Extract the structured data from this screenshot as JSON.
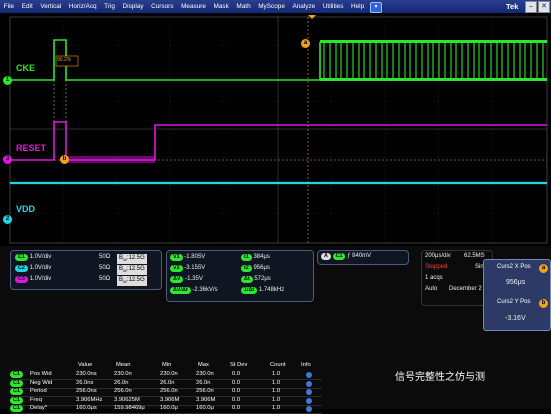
{
  "menubar": {
    "items": [
      "File",
      "Edit",
      "Vertical",
      "Horiz/Acq",
      "Trig",
      "Display",
      "Cursors",
      "Measure",
      "Mask",
      "Math",
      "MyScope",
      "Analyze",
      "Utilities",
      "Help"
    ],
    "help_glyph": "▾",
    "brand": "Tek",
    "min_glyph": "–",
    "close_glyph": "✕"
  },
  "waveform": {
    "channels": [
      {
        "label": "CKE",
        "marker": "1",
        "color": "#2ee62e"
      },
      {
        "label": "RESET",
        "marker": "3",
        "color": "#e016e0"
      },
      {
        "label": "VDD",
        "marker": "2",
        "color": "#1ed7e6"
      }
    ],
    "cursor_tags": {
      "a": "a",
      "b": "b"
    },
    "delta_readout": "90.2%",
    "trigger_marker": "T"
  },
  "channel_panel": {
    "rows": [
      {
        "ch": "C1",
        "scale": "1.0V/div",
        "imp": "50Ω",
        "bw_sym": "B",
        "bw_sub": "W",
        "bw": "12.5G"
      },
      {
        "ch": "C2",
        "scale": "1.0V/div",
        "imp": "50Ω",
        "bw_sym": "B",
        "bw_sub": "W",
        "bw": "12.5G"
      },
      {
        "ch": "C3",
        "scale": "1.0V/div",
        "imp": "50Ω",
        "bw_sym": "B",
        "bw_sub": "W",
        "bw": "12.5G"
      }
    ]
  },
  "cursor_panel": {
    "rows": [
      {
        "tag": "V1",
        "value": "-1.805V",
        "tag2": "t1",
        "value2": "384μs"
      },
      {
        "tag": "V2",
        "value": "-3.155V",
        "tag2": "t2",
        "value2": "956μs"
      },
      {
        "tag": "ΔV",
        "value": "-1.35V",
        "tag2": "Δt",
        "value2": "572μs"
      },
      {
        "tag": "ΔV/Δt",
        "value": "-2.36kV/s",
        "tag2": "1/Δt",
        "value2": "1.748kHz"
      }
    ]
  },
  "trigger_panel": {
    "source": "C1",
    "slope": "ƒ",
    "level": "840mV"
  },
  "acq_panel": {
    "timebase": "200μs/div",
    "rate": "62.5MS",
    "state": "Stopped",
    "single": "Sin",
    "acqs": "1 acqs",
    "mode": "Auto",
    "date": "December 2"
  },
  "cursor_popup": {
    "x_title": "Curs2 X Pos",
    "x_value": "956μs",
    "y_title": "Curs2 Y Pos",
    "y_value": "-3.16V",
    "x_tag": "a",
    "y_tag": "b"
  },
  "measurements": {
    "headers": [
      "Value",
      "Mean",
      "Min",
      "Max",
      "St Dev",
      "Count",
      "Info"
    ],
    "rows": [
      {
        "ch": "C1",
        "name": "Pos Wid",
        "cells": [
          "230.0ns",
          "230.0n",
          "230.0n",
          "230.0n",
          "0.0",
          "1.0"
        ]
      },
      {
        "ch": "C1",
        "name": "Neg Wid",
        "cells": [
          "26.0ns",
          "26.0n",
          "26.0n",
          "26.0n",
          "0.0",
          "1.0"
        ]
      },
      {
        "ch": "C1",
        "name": "Period",
        "cells": [
          "256.0ns",
          "256.0n",
          "256.0n",
          "256.0n",
          "0.0",
          "1.0"
        ]
      },
      {
        "ch": "C1",
        "name": "Freq",
        "cells": [
          "3.906MHz",
          "3.90625M",
          "3.906M",
          "3.906M",
          "0.0",
          "1.0"
        ]
      },
      {
        "ch": "C1",
        "name": "Delay*",
        "cells": [
          "160.0μs",
          "159.98469μ",
          "160.0μ",
          "160.0μ",
          "0.0",
          "1.0"
        ]
      }
    ]
  },
  "watermark": {
    "text": "信号完整性之仿与测"
  },
  "colors": {
    "ch1": "#2ee62e",
    "ch2": "#1ed7e6",
    "ch3": "#e016e0",
    "cursor": "#f0a21a",
    "menubar": "#1b2f80"
  }
}
